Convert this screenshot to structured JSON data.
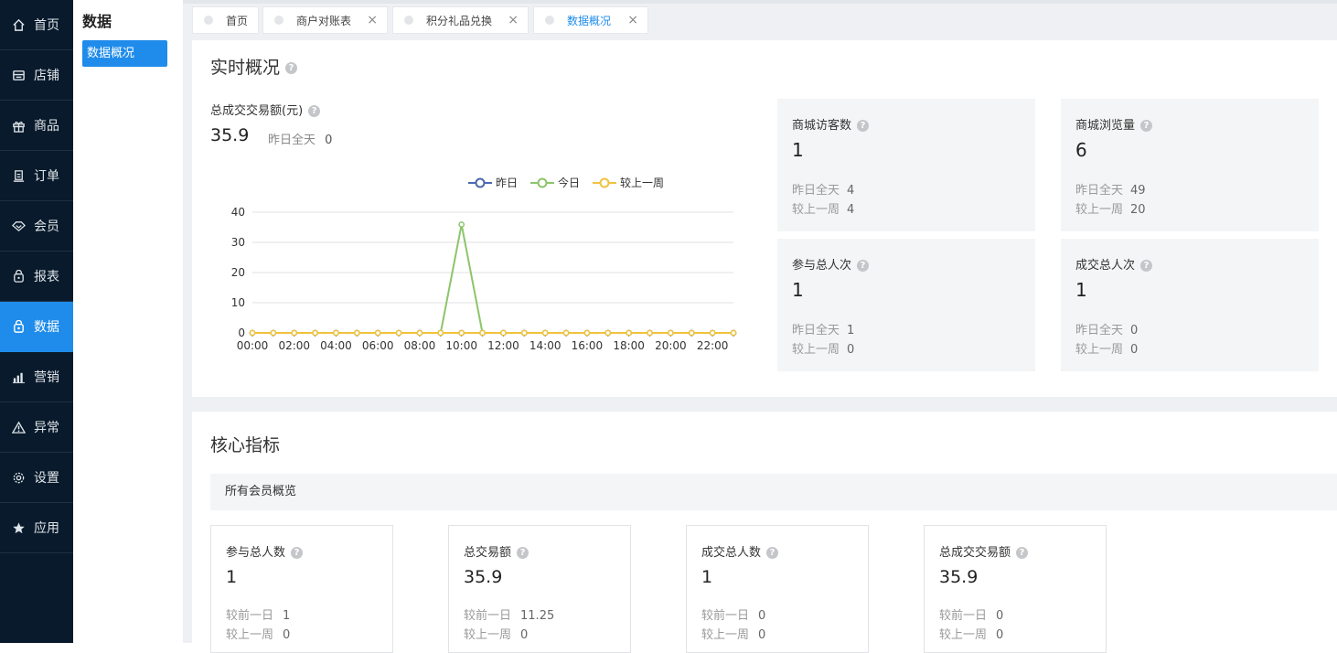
{
  "nav": {
    "items": [
      {
        "label": "首页",
        "icon": "home-icon"
      },
      {
        "label": "店铺",
        "icon": "store-icon"
      },
      {
        "label": "商品",
        "icon": "gift-icon"
      },
      {
        "label": "订单",
        "icon": "order-icon"
      },
      {
        "label": "会员",
        "icon": "member-icon"
      },
      {
        "label": "报表",
        "icon": "report-icon"
      },
      {
        "label": "数据",
        "icon": "data-icon"
      },
      {
        "label": "营销",
        "icon": "bar-chart-icon"
      },
      {
        "label": "异常",
        "icon": "warning-icon"
      },
      {
        "label": "设置",
        "icon": "gear-icon"
      },
      {
        "label": "应用",
        "icon": "star-icon"
      }
    ],
    "active_index": 6,
    "active_color": "#1f8ceb",
    "bg_color": "#081a2b"
  },
  "subnav": {
    "title": "数据",
    "items": [
      {
        "label": "数据概况"
      }
    ]
  },
  "tabs": [
    {
      "label": "首页",
      "closable": false,
      "active": false
    },
    {
      "label": "商户对账表",
      "closable": true,
      "active": false
    },
    {
      "label": "积分礼品兑换",
      "closable": true,
      "active": false
    },
    {
      "label": "数据概况",
      "closable": true,
      "active": true
    }
  ],
  "tab_close_glyph": "×",
  "help_glyph": "?",
  "realtime": {
    "title": "实时概况",
    "total_label": "总成交交易额(元)",
    "total_value": "35.9",
    "yesterday_label": "昨日全天",
    "yesterday_value": "0",
    "stats": [
      {
        "title": "商城访客数",
        "value": "1",
        "r1_label": "昨日全天",
        "r1_value": "4",
        "r2_label": "较上一周",
        "r2_value": "4"
      },
      {
        "title": "商城浏览量",
        "value": "6",
        "r1_label": "昨日全天",
        "r1_value": "49",
        "r2_label": "较上一周",
        "r2_value": "20"
      },
      {
        "title": "参与总人次",
        "value": "1",
        "r1_label": "昨日全天",
        "r1_value": "1",
        "r2_label": "较上一周",
        "r2_value": "0"
      },
      {
        "title": "成交总人次",
        "value": "1",
        "r1_label": "昨日全天",
        "r1_value": "0",
        "r2_label": "较上一周",
        "r2_value": "0"
      }
    ]
  },
  "core": {
    "title": "核心指标",
    "subhead": "所有会员概览",
    "cards": [
      {
        "title": "参与总人数",
        "value": "1",
        "r1_label": "较前一日",
        "r1_value": "1",
        "r2_label": "较上一周",
        "r2_value": "0"
      },
      {
        "title": "总交易额",
        "value": "35.9",
        "r1_label": "较前一日",
        "r1_value": "11.25",
        "r2_label": "较上一周",
        "r2_value": "0"
      },
      {
        "title": "成交总人数",
        "value": "1",
        "r1_label": "较前一日",
        "r1_value": "0",
        "r2_label": "较上一周",
        "r2_value": "0"
      },
      {
        "title": "总成交交易额",
        "value": "35.9",
        "r1_label": "较前一日",
        "r1_value": "0",
        "r2_label": "较上一周",
        "r2_value": "0"
      }
    ]
  },
  "chart_data": {
    "type": "line",
    "x": [
      "00:00",
      "01:00",
      "02:00",
      "03:00",
      "04:00",
      "05:00",
      "06:00",
      "07:00",
      "08:00",
      "09:00",
      "10:00",
      "11:00",
      "12:00",
      "13:00",
      "14:00",
      "15:00",
      "16:00",
      "17:00",
      "18:00",
      "19:00",
      "20:00",
      "21:00",
      "22:00",
      "23:00"
    ],
    "x_tick_labels": [
      "00:00",
      "02:00",
      "04:00",
      "06:00",
      "08:00",
      "10:00",
      "12:00",
      "14:00",
      "16:00",
      "18:00",
      "20:00",
      "22:00"
    ],
    "ylim": [
      0,
      40
    ],
    "y_ticks": [
      0,
      10,
      20,
      30,
      40
    ],
    "grid": true,
    "legend_position": "top",
    "series": [
      {
        "name": "昨日",
        "color": "#4a67b1",
        "values": [
          0,
          0,
          0,
          0,
          0,
          0,
          0,
          0,
          0,
          0,
          0,
          0,
          0,
          0,
          0,
          0,
          0,
          0,
          0,
          0,
          0,
          0,
          0,
          0
        ]
      },
      {
        "name": "今日",
        "color": "#8cc56b",
        "values": [
          0,
          0,
          0,
          0,
          0,
          0,
          0,
          0,
          0,
          0,
          35.9,
          0,
          0,
          0,
          0,
          0,
          0,
          0,
          0,
          0,
          0,
          0,
          0,
          0
        ]
      },
      {
        "name": "较上一周",
        "color": "#f0c23e",
        "values": [
          0,
          0,
          0,
          0,
          0,
          0,
          0,
          0,
          0,
          0,
          0,
          0,
          0,
          0,
          0,
          0,
          0,
          0,
          0,
          0,
          0,
          0,
          0,
          0
        ]
      }
    ]
  }
}
